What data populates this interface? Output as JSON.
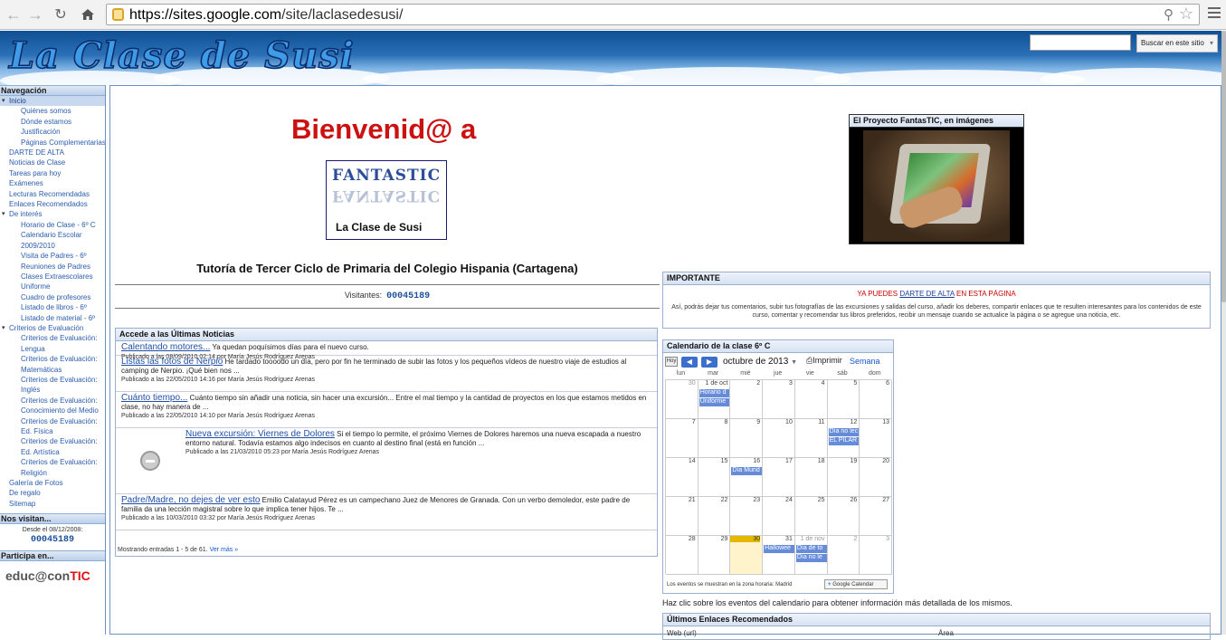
{
  "browser": {
    "url_host": "https://sites.google.com",
    "url_path": "/site/laclasedesusi/"
  },
  "site": {
    "title": "La Clase de Susi",
    "search_button": "Buscar en este sitio"
  },
  "sidebar": {
    "nav_header": "Navegación",
    "items": [
      {
        "label": "Inicio",
        "level": 1,
        "selected": true,
        "expanded": true
      },
      {
        "label": "Quiénes somos",
        "level": 2
      },
      {
        "label": "Dónde estamos",
        "level": 2
      },
      {
        "label": "Justificación",
        "level": 2
      },
      {
        "label": "Páginas Complementarias",
        "level": 2
      },
      {
        "label": "DARTE DE ALTA",
        "level": 1
      },
      {
        "label": "Noticias de Clase",
        "level": 1
      },
      {
        "label": "Tareas para hoy",
        "level": 1
      },
      {
        "label": "Exámenes",
        "level": 1
      },
      {
        "label": "Lecturas Recomendadas",
        "level": 1
      },
      {
        "label": "Enlaces Recomendados",
        "level": 1
      },
      {
        "label": "De interés",
        "level": 1,
        "expanded": true
      },
      {
        "label": "Horario de Clase - 6º C",
        "level": 2
      },
      {
        "label": "Calendario Escolar",
        "level": 2
      },
      {
        "label": "2009/2010",
        "level": 2
      },
      {
        "label": "Visita de Padres - 6º",
        "level": 2
      },
      {
        "label": "Reuniones de Padres",
        "level": 2
      },
      {
        "label": "Clases Extraescolares",
        "level": 2
      },
      {
        "label": "Uniforme",
        "level": 2
      },
      {
        "label": "Cuadro de profesores",
        "level": 2
      },
      {
        "label": "Listado de libros - 6º",
        "level": 2
      },
      {
        "label": "Listado de material - 6º",
        "level": 2
      },
      {
        "label": "Criterios de Evaluación",
        "level": 1,
        "expanded": true
      },
      {
        "label": "Criterios de Evaluación:",
        "level": 2
      },
      {
        "label": "Lengua",
        "level": 2
      },
      {
        "label": "Criterios de Evaluación:",
        "level": 2
      },
      {
        "label": "Matemáticas",
        "level": 2
      },
      {
        "label": "Criterios de Evaluación:",
        "level": 2
      },
      {
        "label": "Inglés",
        "level": 2
      },
      {
        "label": "Criterios de Evaluación:",
        "level": 2
      },
      {
        "label": "Conocimiento del Medio",
        "level": 2
      },
      {
        "label": "Criterios de Evaluación:",
        "level": 2
      },
      {
        "label": "Ed. Física",
        "level": 2
      },
      {
        "label": "Criterios de Evaluación:",
        "level": 2
      },
      {
        "label": "Ed. Artística",
        "level": 2
      },
      {
        "label": "Criterios de Evaluación:",
        "level": 2
      },
      {
        "label": "Religión",
        "level": 2
      },
      {
        "label": "Galería de Fotos",
        "level": 1
      },
      {
        "label": "De regalo",
        "level": 1
      },
      {
        "label": "Sitemap",
        "level": 1
      }
    ],
    "visits_header": "Nos visitan...",
    "visits_since": "Desde el 08/12/2008:",
    "visits_count": "00045189",
    "participa_header": "Participa en...",
    "participa_logo_a": "educ@con",
    "participa_logo_b": "TIC"
  },
  "main": {
    "welcome": "Bienvenid@ a",
    "logo_word": "FANTASTIC",
    "logo_sub": "La Clase de Susi",
    "tutoria": "Tutoría de Tercer Ciclo de Primaria del Colegio Hispania (Cartagena)",
    "visitors_label": "Visitantes:",
    "visitors_count": "00045189"
  },
  "news": {
    "header": "Accede a las Últimas Noticias",
    "items": [
      {
        "title": "Calentando motores...",
        "text": "Ya quedan poquísimos días para el nuevo curso.",
        "pub": "Publicado a las 08/09/2010 02:14 por María Jesús Rodríguez Arenas"
      },
      {
        "title": "Listas las fotos de Nerpio",
        "text": "He tardado toooodo un día, pero por fin he terminado de subir las fotos y los pequeños vídeos de nuestro viaje de estudios al camping de Nerpio. ¡Qué bien nos ...",
        "pub": "Publicado a las 22/05/2010 14:16 por María Jesús Rodríguez Arenas"
      },
      {
        "title": "Cuánto tiempo...",
        "text": "Cuánto tiempo sin añadir una noticia, sin hacer una excursión... Entre el mal tiempo y la cantidad de proyectos en los que estamos metidos en clase, no hay manera de ...",
        "pub": "Publicado a las 22/05/2010 14:10 por María Jesús Rodríguez Arenas"
      },
      {
        "title": "Nueva excursión: Viernes de Dolores",
        "text": "Si el tiempo lo permite, el próximo Viernes de Dolores haremos una nueva escapada a nuestro entorno natural. Todavía estamos algo indecisos en cuanto al destino final (está en función ...",
        "pub": "Publicado a las 21/03/2010 05:23 por María Jesús Rodríguez Arenas"
      },
      {
        "title": "Padre/Madre, no dejes de ver esto",
        "text": "Emilio Calatayud Pérez es un campechano Juez de Menores de Granada. Con un verbo demoledor, este padre de familia da una lección magistral sobre lo que implica tener hijos. Te ...",
        "pub": "Publicado a las 10/03/2010 03:32 por María Jesús Rodríguez Arenas"
      }
    ],
    "footer": "Mostrando entradas 1 - 5 de 61.",
    "more": "Ver más »"
  },
  "video": {
    "header": "El Proyecto FantasTIC, en imágenes"
  },
  "important": {
    "header": "IMPORTANTE",
    "line_pre": "YA PUEDES ",
    "line_link": "DARTE DE ALTA",
    "line_post": " EN ESTA PÁGINA",
    "body": "Así, podrás dejar tus comentarios, subir tus fotografías de las excursiones y salidas del curso, añadir los deberes, compartir enlaces que te resulten interesantes para los contenidos de este curso, comentar y recomendar tus libros preferidos, recibir un mensaje cuando se actualice la página o se agregue una noticia, etc."
  },
  "calendar": {
    "header": "Calendario de la clase 6º C",
    "today_btn": "Hoy",
    "month": "octubre de 2013",
    "print": "Imprimir",
    "tab_week": "Semana",
    "dow": [
      "lun",
      "mar",
      "mié",
      "jue",
      "vie",
      "sáb",
      "dom"
    ],
    "weeks": [
      [
        "30",
        "1 de oct",
        "2",
        "3",
        "4",
        "5",
        "6"
      ],
      [
        "7",
        "8",
        "9",
        "10",
        "11",
        "12",
        "13"
      ],
      [
        "14",
        "15",
        "16",
        "17",
        "18",
        "19",
        "20"
      ],
      [
        "21",
        "22",
        "23",
        "24",
        "25",
        "26",
        "27"
      ],
      [
        "28",
        "29",
        "30",
        "31",
        "1 de nov",
        "2",
        "3"
      ]
    ],
    "events": [
      {
        "week": 0,
        "day": 1,
        "slot": 0,
        "label": "Horario d"
      },
      {
        "week": 0,
        "day": 1,
        "slot": 1,
        "label": "Uniforme"
      },
      {
        "week": 1,
        "day": 5,
        "slot": 0,
        "label": "Día no lec"
      },
      {
        "week": 1,
        "day": 5,
        "slot": 1,
        "label": "EL PILAR"
      },
      {
        "week": 2,
        "day": 2,
        "slot": 0,
        "label": "Día Mund"
      },
      {
        "week": 4,
        "day": 3,
        "slot": 0,
        "label": "Hallowee"
      },
      {
        "week": 4,
        "day": 4,
        "slot": 0,
        "label": "Día de to"
      },
      {
        "week": 4,
        "day": 4,
        "slot": 1,
        "label": "Día no le"
      }
    ],
    "today": {
      "week": 4,
      "day": 2
    },
    "timezone": "Los eventos se muestran en la zona horaria: Madrid",
    "gcal": "Google Calendar",
    "hint": "Haz clic sobre los eventos del calendario para obtener información más detallada de los mismos."
  },
  "links": {
    "header": "Últimos Enlaces Recomendados",
    "col1": "Web (url)",
    "col2": "Área"
  }
}
